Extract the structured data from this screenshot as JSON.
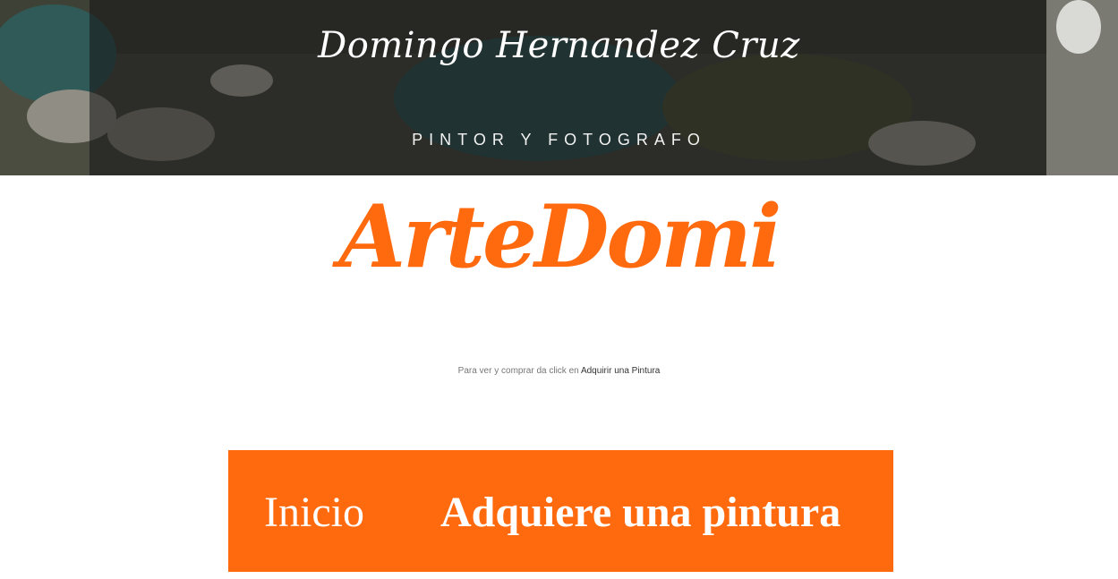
{
  "hero": {
    "title": "Domingo Hernandez Cruz",
    "subtitle": "PINTOR Y FOTOGRAFO"
  },
  "brand": {
    "logo_text": "ArteDomi",
    "color": "#ff6a0f"
  },
  "notice": {
    "prefix": "Para ver y comprar da click en",
    "link_label": "Adquirir una Pintura"
  },
  "nav": {
    "background": "#ff6a0f",
    "items": [
      {
        "label": "Inicio"
      },
      {
        "label": "Adquiere una pintura"
      }
    ]
  }
}
